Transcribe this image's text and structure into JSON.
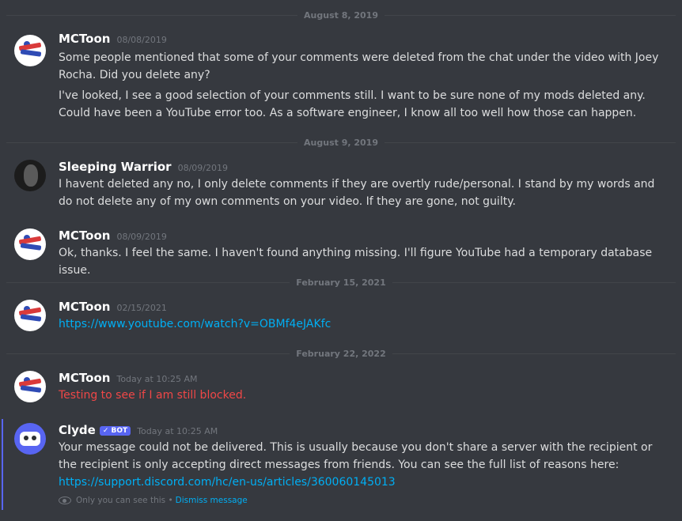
{
  "dividers": [
    "August 8, 2019",
    "August 9, 2019",
    "February 15, 2021",
    "February 22, 2022"
  ],
  "messages": [
    {
      "author": "MCToon",
      "timestamp": "08/08/2019",
      "paragraphs": [
        "Some people mentioned that some of your comments were deleted from the chat under the video with Joey Rocha.  Did you delete any?",
        "I've looked, I see a good selection of your comments still.  I want to be sure none of my mods deleted any.  Could have been a YouTube error too.  As a software engineer, I know all too well how those can happen."
      ]
    },
    {
      "author": "Sleeping Warrior",
      "timestamp": "08/09/2019",
      "paragraphs": [
        "I havent deleted any no, I only delete comments if they are overtly rude/personal. I stand by my words and do not delete any of my own comments on your video. If they are gone, not guilty."
      ]
    },
    {
      "author": "MCToon",
      "timestamp": "08/09/2019",
      "paragraphs": [
        "Ok, thanks.  I feel the same.  I haven't found anything missing.  I'll figure YouTube had a temporary database issue."
      ]
    },
    {
      "author": "MCToon",
      "timestamp": "02/15/2021",
      "link": "https://www.youtube.com/watch?v=OBMf4eJAKfc"
    },
    {
      "author": "MCToon",
      "timestamp": "Today at 10:25 AM",
      "failed_text": "Testing to see if I am still blocked."
    },
    {
      "author": "Clyde",
      "bot_tag": "BOT",
      "timestamp": "Today at 10:25 AM",
      "text": "Your message could not be delivered. This is usually because you don't share a server with the recipient or the recipient is only accepting direct messages from friends. You can see the full list of reasons here:",
      "link": "https://support.discord.com/hc/en-us/articles/360060145013",
      "ephemeral_note": "Only you can see this •",
      "dismiss_label": "Dismiss message"
    }
  ],
  "colors": {
    "background": "#36393f",
    "link": "#00aff4",
    "error_text": "#f04747",
    "bot_accent": "#5865f2"
  }
}
